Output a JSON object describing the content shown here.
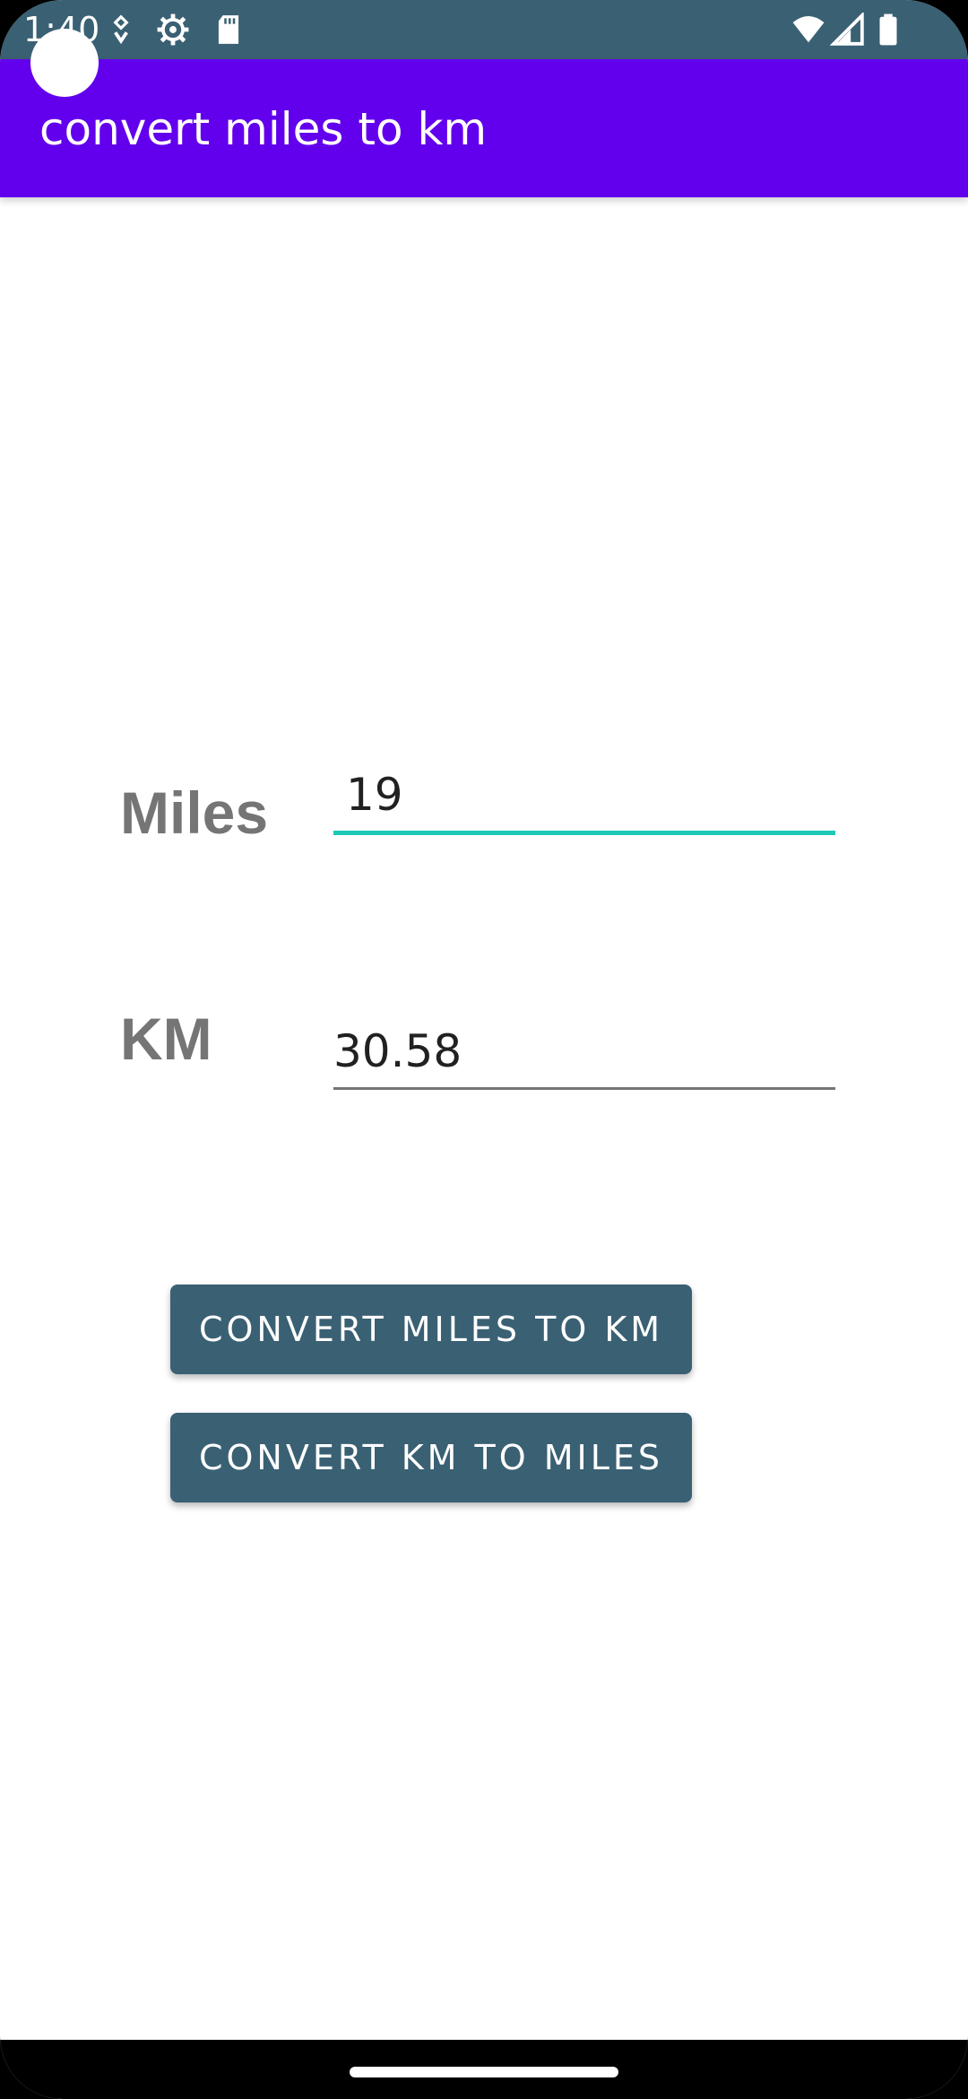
{
  "status_bar": {
    "time": "1:40",
    "icons": [
      "notification-icon",
      "settings-icon",
      "sd-card-icon",
      "wifi-icon",
      "signal-icon",
      "battery-icon"
    ]
  },
  "app_bar": {
    "title": "convert miles to km",
    "color": "#6200ee"
  },
  "form": {
    "miles_label": "Miles",
    "miles_value": "19",
    "km_label": "KM",
    "km_value": "30.58"
  },
  "buttons": {
    "miles_to_km": "CONVERT MILES TO KM",
    "km_to_miles": "CONVERT KM TO MILES"
  },
  "colors": {
    "status_bar": "#3a6073",
    "button": "#3a6073",
    "active_underline": "#1ec9b6"
  }
}
